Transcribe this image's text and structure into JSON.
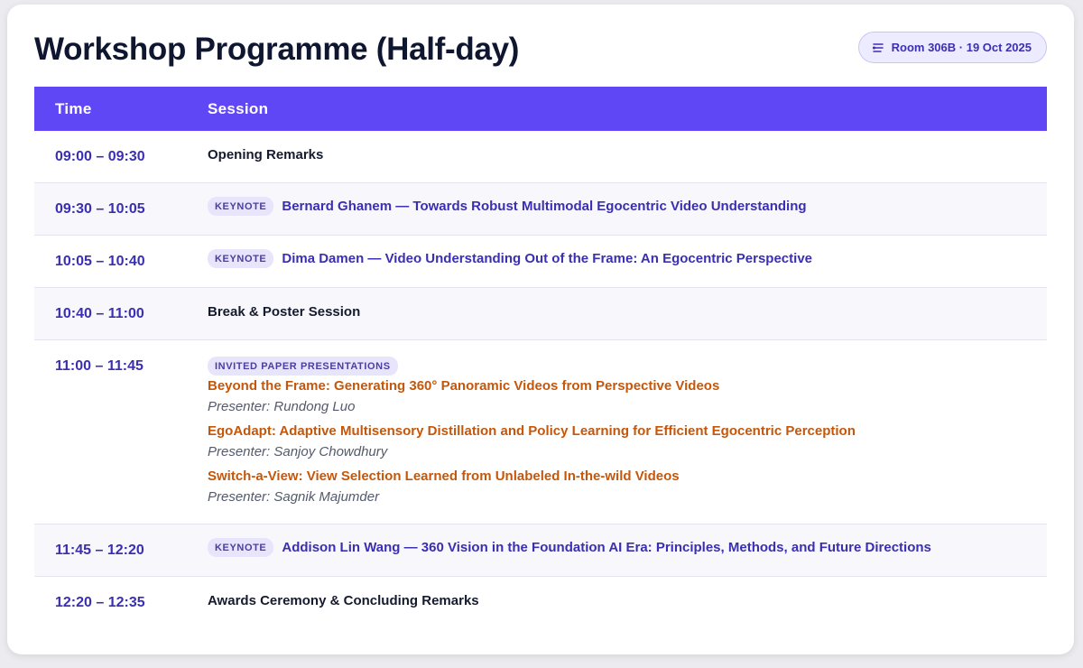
{
  "header": {
    "title": "Workshop Programme (Half-day)",
    "badge": "Room 306B · 19 Oct 2025",
    "badge_icon": "schedule-icon"
  },
  "table": {
    "columns": [
      "Time",
      "Session"
    ],
    "rows": [
      {
        "time": "09:00 – 09:30",
        "type": "plain",
        "text": "Opening Remarks"
      },
      {
        "time": "09:30 – 10:05",
        "type": "keynote",
        "tag": "KEYNOTE",
        "text": "Bernard Ghanem — Towards Robust Multimodal Egocentric Video Understanding"
      },
      {
        "time": "10:05 – 10:40",
        "type": "keynote",
        "tag": "KEYNOTE",
        "text": "Dima Damen — Video Understanding Out of the Frame: An Egocentric Perspective"
      },
      {
        "time": "10:40 – 11:00",
        "type": "plain",
        "text": "Break & Poster Session"
      },
      {
        "time": "11:00 – 11:45",
        "type": "papers",
        "tag": "INVITED PAPER PRESENTATIONS",
        "papers": [
          {
            "title": "Beyond the Frame: Generating 360° Panoramic Videos from Perspective Videos",
            "presenter": "Presenter: Rundong Luo"
          },
          {
            "title": "EgoAdapt: Adaptive Multisensory Distillation and Policy Learning for Efficient Egocentric Perception",
            "presenter": "Presenter: Sanjoy Chowdhury"
          },
          {
            "title": "Switch-a-View: View Selection Learned from Unlabeled In-the-wild Videos",
            "presenter": "Presenter: Sagnik Majumder"
          }
        ]
      },
      {
        "time": "11:45 – 12:20",
        "type": "keynote",
        "tag": "KEYNOTE",
        "text": "Addison Lin Wang — 360 Vision in the Foundation AI Era: Principles, Methods, and Future Directions"
      },
      {
        "time": "12:20 – 12:35",
        "type": "plain",
        "text": "Awards Ceremony & Concluding Remarks"
      }
    ]
  },
  "colors": {
    "header_bg": "#6047f6",
    "time_text": "#3a2fb0",
    "paper_title": "#c4570b",
    "pill_bg": "#e7e4fb"
  }
}
